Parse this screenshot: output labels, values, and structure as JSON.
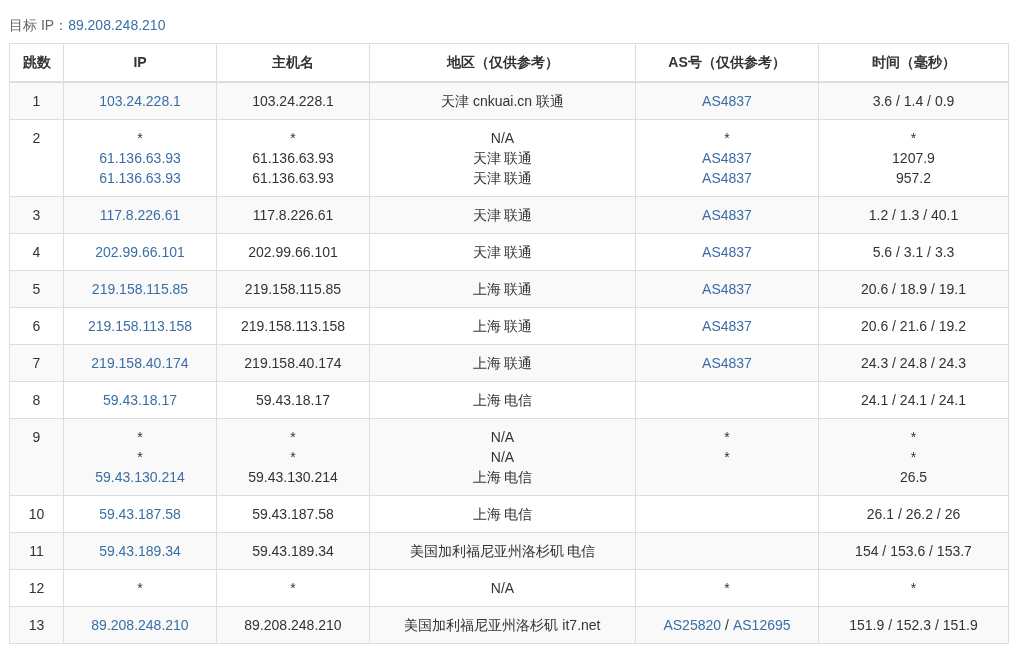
{
  "target": {
    "label": "目标 IP：",
    "value": "89.208.248.210"
  },
  "columns": [
    "跳数",
    "IP",
    "主机名",
    "地区（仅供参考）",
    "AS号（仅供参考）",
    "时间（毫秒）"
  ],
  "rows": [
    {
      "hop": "1",
      "ip": [
        {
          "text": "103.24.228.1",
          "link": true
        }
      ],
      "host": [
        "103.24.228.1"
      ],
      "region": [
        "天津 cnkuai.cn 联通"
      ],
      "as": [
        [
          {
            "text": "AS4837",
            "link": true
          }
        ]
      ],
      "time": [
        "3.6 / 1.4 / 0.9"
      ]
    },
    {
      "hop": "2",
      "ip": [
        {
          "text": "*",
          "link": false
        },
        {
          "text": "61.136.63.93",
          "link": true
        },
        {
          "text": "61.136.63.93",
          "link": true
        }
      ],
      "host": [
        "*",
        "61.136.63.93",
        "61.136.63.93"
      ],
      "region": [
        "N/A",
        "天津 联通",
        "天津 联通"
      ],
      "as": [
        [
          {
            "text": "*",
            "link": false
          }
        ],
        [
          {
            "text": "AS4837",
            "link": true
          }
        ],
        [
          {
            "text": "AS4837",
            "link": true
          }
        ]
      ],
      "time": [
        "*",
        "1207.9",
        "957.2"
      ]
    },
    {
      "hop": "3",
      "ip": [
        {
          "text": "117.8.226.61",
          "link": true
        }
      ],
      "host": [
        "117.8.226.61"
      ],
      "region": [
        "天津 联通"
      ],
      "as": [
        [
          {
            "text": "AS4837",
            "link": true
          }
        ]
      ],
      "time": [
        "1.2 / 1.3 / 40.1"
      ]
    },
    {
      "hop": "4",
      "ip": [
        {
          "text": "202.99.66.101",
          "link": true
        }
      ],
      "host": [
        "202.99.66.101"
      ],
      "region": [
        "天津 联通"
      ],
      "as": [
        [
          {
            "text": "AS4837",
            "link": true
          }
        ]
      ],
      "time": [
        "5.6 / 3.1 / 3.3"
      ]
    },
    {
      "hop": "5",
      "ip": [
        {
          "text": "219.158.115.85",
          "link": true
        }
      ],
      "host": [
        "219.158.115.85"
      ],
      "region": [
        "上海 联通"
      ],
      "as": [
        [
          {
            "text": "AS4837",
            "link": true
          }
        ]
      ],
      "time": [
        "20.6 / 18.9 / 19.1"
      ]
    },
    {
      "hop": "6",
      "ip": [
        {
          "text": "219.158.113.158",
          "link": true
        }
      ],
      "host": [
        "219.158.113.158"
      ],
      "region": [
        "上海 联通"
      ],
      "as": [
        [
          {
            "text": "AS4837",
            "link": true
          }
        ]
      ],
      "time": [
        "20.6 / 21.6 / 19.2"
      ]
    },
    {
      "hop": "7",
      "ip": [
        {
          "text": "219.158.40.174",
          "link": true
        }
      ],
      "host": [
        "219.158.40.174"
      ],
      "region": [
        "上海 联通"
      ],
      "as": [
        [
          {
            "text": "AS4837",
            "link": true
          }
        ]
      ],
      "time": [
        "24.3 / 24.8 / 24.3"
      ]
    },
    {
      "hop": "8",
      "ip": [
        {
          "text": "59.43.18.17",
          "link": true
        }
      ],
      "host": [
        "59.43.18.17"
      ],
      "region": [
        "上海 电信"
      ],
      "time": [
        "24.1 / 24.1 / 24.1"
      ]
    },
    {
      "hop": "9",
      "ip": [
        {
          "text": "*",
          "link": false
        },
        {
          "text": "*",
          "link": false
        },
        {
          "text": "59.43.130.214",
          "link": true
        }
      ],
      "host": [
        "*",
        "*",
        "59.43.130.214"
      ],
      "region": [
        "N/A",
        "N/A",
        "上海 电信"
      ],
      "as": [
        [
          {
            "text": "*",
            "link": false
          }
        ],
        [
          {
            "text": "*",
            "link": false
          }
        ]
      ],
      "time": [
        "*",
        "*",
        "26.5"
      ]
    },
    {
      "hop": "10",
      "ip": [
        {
          "text": "59.43.187.58",
          "link": true
        }
      ],
      "host": [
        "59.43.187.58"
      ],
      "region": [
        "上海 电信"
      ],
      "time": [
        "26.1 / 26.2 / 26"
      ]
    },
    {
      "hop": "11",
      "ip": [
        {
          "text": "59.43.189.34",
          "link": true
        }
      ],
      "host": [
        "59.43.189.34"
      ],
      "region": [
        "美国加利福尼亚州洛杉矶 电信"
      ],
      "time": [
        "154 / 153.6 / 153.7"
      ]
    },
    {
      "hop": "12",
      "ip": [
        {
          "text": "*",
          "link": false
        }
      ],
      "host": [
        "*"
      ],
      "region": [
        "N/A"
      ],
      "as": [
        [
          {
            "text": "*",
            "link": false
          }
        ]
      ],
      "time": [
        "*"
      ]
    },
    {
      "hop": "13",
      "ip": [
        {
          "text": "89.208.248.210",
          "link": true
        }
      ],
      "host": [
        "89.208.248.210"
      ],
      "region": [
        "美国加利福尼亚州洛杉矶 it7.net"
      ],
      "as": [
        [
          {
            "text": "AS25820",
            "link": true
          },
          {
            "text": "/",
            "link": false
          },
          {
            "text": "AS12695",
            "link": true
          }
        ]
      ],
      "time": [
        "151.9 / 152.3 / 151.9"
      ]
    }
  ]
}
